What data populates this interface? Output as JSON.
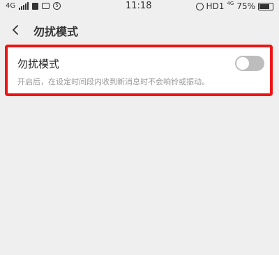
{
  "status_bar": {
    "network": "4G",
    "time": "11:18",
    "hd": "HD1",
    "network_small": "4G",
    "battery": "75%",
    "circle_icon_text": "5"
  },
  "header": {
    "title": "勿扰模式"
  },
  "setting": {
    "label": "勿扰模式",
    "description": "开启后，在设定时间段内收到新消息时不会响铃或振动。",
    "enabled": false
  },
  "colors": {
    "highlight_border": "#ee1414",
    "toggle_off": "#bdbdbd",
    "background": "#efefef"
  }
}
